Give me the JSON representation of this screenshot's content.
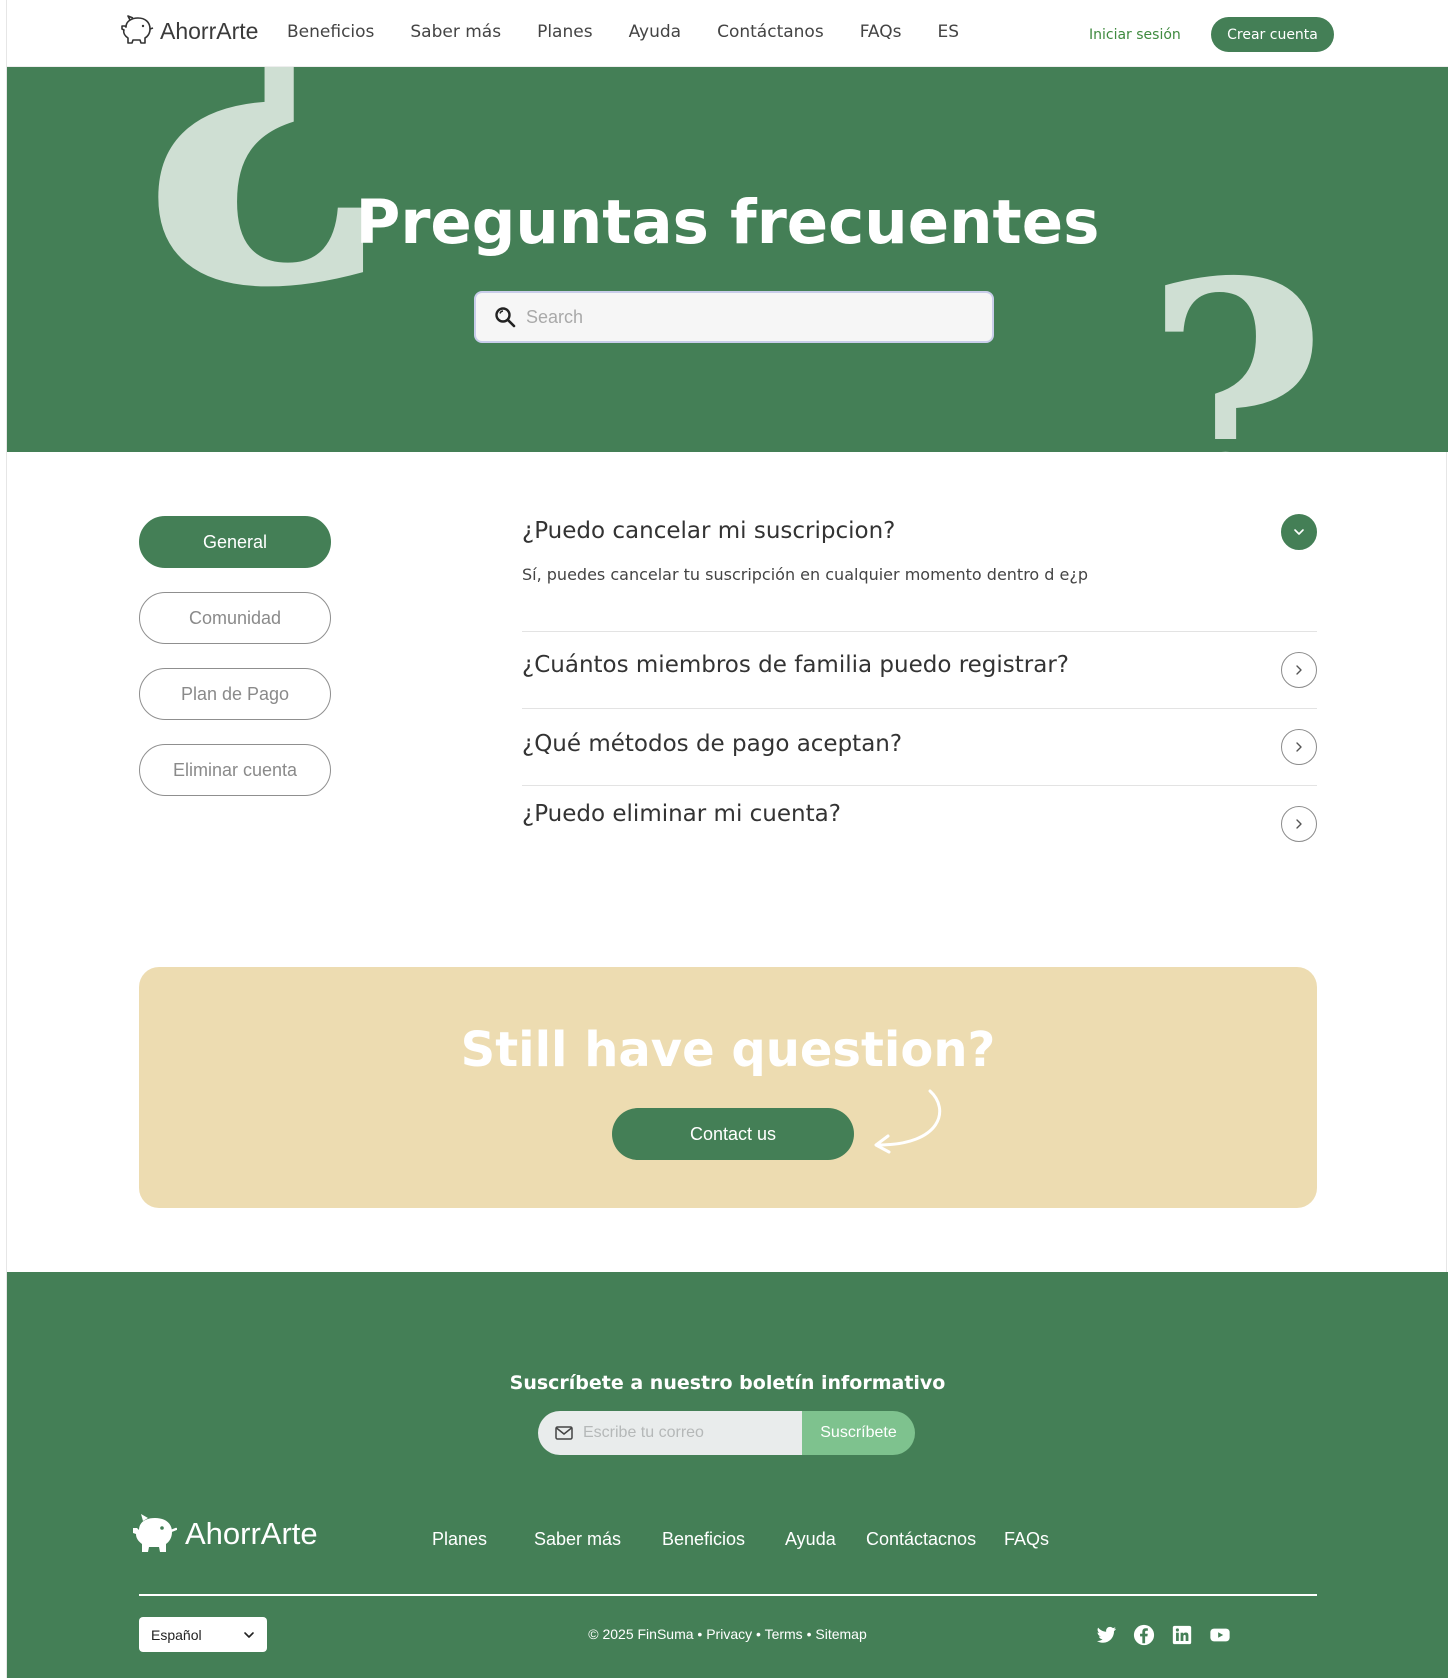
{
  "header": {
    "logo_text": "AhorrArte",
    "nav": [
      "Beneficios",
      "Saber más",
      "Planes",
      "Ayuda",
      "Contáctanos",
      "FAQs",
      "ES"
    ],
    "login_label": "Iniciar sesión",
    "signup_label": "Crear cuenta"
  },
  "hero": {
    "title": "Preguntas frecuentes",
    "search_placeholder": "Search",
    "decor_open": "¿",
    "decor_close": "?"
  },
  "categories": [
    {
      "label": "General",
      "active": true
    },
    {
      "label": "Comunidad",
      "active": false
    },
    {
      "label": "Plan de Pago",
      "active": false
    },
    {
      "label": "Eliminar cuenta",
      "active": false
    }
  ],
  "faqs": [
    {
      "question": "¿Puedo cancelar mi suscripcion?",
      "answer": "Sí, puedes cancelar tu suscripción en cualquier momento dentro d e¿p",
      "expanded": true
    },
    {
      "question": "¿Cuántos miembros de familia puedo registrar?",
      "expanded": false
    },
    {
      "question": "¿Qué métodos de pago aceptan?",
      "expanded": false
    },
    {
      "question": "¿Puedo eliminar mi cuenta?",
      "expanded": false
    }
  ],
  "cta": {
    "title": "Still have question?",
    "button_label": "Contact us"
  },
  "footer": {
    "newsletter_title": "Suscríbete a nuestro boletín informativo",
    "email_placeholder": "Escribe tu correo",
    "subscribe_label": "Suscríbete",
    "logo_text": "AhorrArte",
    "nav": [
      "Planes",
      "Saber más",
      "Beneficios",
      "Ayuda",
      "Contáctacnos",
      "FAQs"
    ],
    "language": "Español",
    "copyright": "© 2025 FinSuma",
    "links": [
      "Privacy",
      "Terms",
      "Sitemap"
    ],
    "social": [
      "twitter-icon",
      "facebook-icon",
      "linkedin-icon",
      "youtube-icon"
    ]
  },
  "colors": {
    "brand_green": "#447f56",
    "light_green": "#7ec28e",
    "cta_bg": "#eddcb1",
    "decor": "#cfdfd3"
  }
}
